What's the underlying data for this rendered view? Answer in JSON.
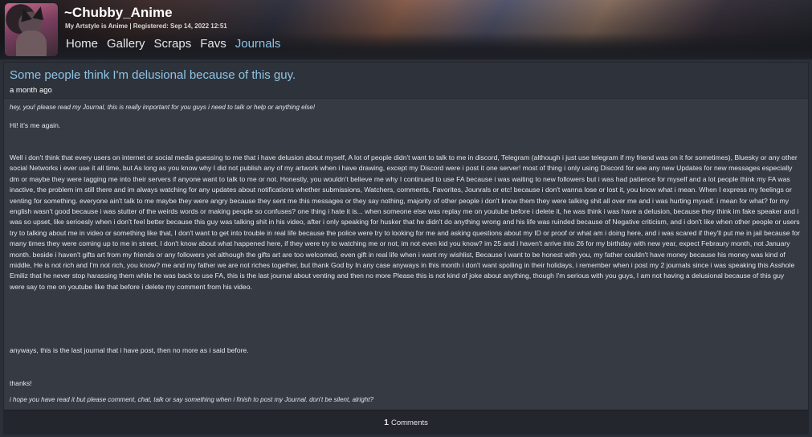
{
  "profile": {
    "username": "~Chubby_Anime",
    "tagline": "My Artstyle is Anime | Registered: Sep 14, 2022 12:51"
  },
  "nav": [
    {
      "label": "Home"
    },
    {
      "label": "Gallery"
    },
    {
      "label": "Scraps"
    },
    {
      "label": "Favs"
    },
    {
      "label": "Journals"
    }
  ],
  "journal": {
    "title": "Some people think I'm delusional because of this guy.",
    "date": "a month ago",
    "header_note": "hey, you! please read my Journal, this is really important for you guys i need to talk or help or anything else!",
    "greeting": "Hi! it's me again.",
    "paragraph": "Well i don't think that every users on internet or social media guessing to me that i have delusion about myself, A lot of people didn't want to talk to me in discord, Telegram (although i just use telegram if my friend was on it for sometimes), Bluesky or any other social Networks i ever use it all time, but As long as you know why I did not publish any of my artwork when i have drawing, except my Discord were i post it one server! most of thing i only using Discord for see any new Updates for new messages especially dm or maybe they were tagging me into their servers if anyone want to talk to me or not. Honestly, you wouldn't believe me why I continued to use FA because i was waiting to new followers but i was had patience for myself and a lot people think my FA was inactive, the problem im still there and im always watching for any updates about notifications whether submissions, Watchers, comments, Favorites, Jounrals or etc! because i don't wanna lose or lost it, you know what i mean. When I express my feelings or venting for something. everyone ain't talk to me maybe they were angry because they sent me this messages or they say nothing, majority of other people i don't know them they were talking shit all over me and i was hurting myself. i mean for what? for my english wasn't good because i was stutter of the weirds words or making people so confuses? one thing i hate it is... when someone else was replay me on youtube before i delete it, he was think i was have a delusion, because they think im fake speaker and i was so upset, like serioesly when i don't feel better because this guy was talking shit in his video, after i only speaking for husker that he didn't do anything wrong and his life was ruinded because of Negative criticism, and i don't like when other people or users try to talking about me in video or something like that, I don't want to get into trouble in real life because the police were try to looking for me and asking questions about my ID or proof or what am i doing here, and i was scared if they'll put me in jail because for many times they were coming up to me in street, I don't know about what happened here, if they were try to watching me or not, im not even kid you know? im 25 and i haven't arrive into 26 for my birthday with new year, expect Febraury month, not January month. beside i haven't gifts art from my friends or any followers yet although the gifts art are too welcomed, even gift in real life when i want my wishlist, Because I want to be honest with you, my father couldn't have money because his money was kind of middle, He is not rich and I'm not rich, you know? me and my father we are not riches together, but thank God by In any case anyways in this month i don't want spoiling in their holidays, i remember when i post my 2 journals since i was speaking this Asshole Emiliz that he never stop harassing them while he was back to use FA, this is the last journal about venting and then no more Please this is not kind of joke about anything, though I'm serious with you guys, I am not having a delusional because of this guy were say to me on youtube like that before i delete my comment from his video.",
    "closing": "anyways, this is the last journal that i have post, then no more as i said before.",
    "thanks": "thanks!",
    "footer_note": "i hope you have read it but please comment, chat, talk or say something when i finish to post my Journal. don't be silent, alright?"
  },
  "comments": {
    "count": "1",
    "label": "Comments"
  }
}
